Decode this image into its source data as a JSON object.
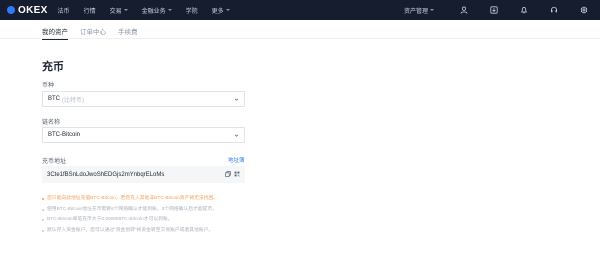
{
  "header": {
    "logo": "OKEX",
    "nav": [
      "法币",
      "行情",
      "交易",
      "金融业务",
      "学院",
      "更多"
    ],
    "asset_menu": "资产管理"
  },
  "subnav": {
    "tabs": [
      "我的资产",
      "订单中心",
      "手续费"
    ],
    "active_tab": "我的资产"
  },
  "page_title": "充币",
  "coin_field": {
    "label": "币种",
    "value": "BTC",
    "hint": "(比特币)"
  },
  "chain_field": {
    "label": "链名称",
    "value": "BTC-Bitcoin"
  },
  "address_field": {
    "label": "充币地址",
    "link": "地址簿",
    "value": "3Cte1fBSnLdoJwoShEDGjs2mYnbqrELoMs"
  },
  "notes": [
    "您只能向此地址充值BTC-Bitcoin，若您充入其他非BTC-Bitcoin资产将无法找回。",
    "使用BTC-Bitcoin地址充币需要6个网络确认才能到账，3个网络确认后才能提币。",
    "BTC-Bitcoin单笔充币大于0.000058TC-Bitcoin才可以到账。",
    "默认存入资金账户，您可以通过“资金划转”将资金转至交易账户或者其他账户。"
  ],
  "colors": {
    "topbar": "#161d2f",
    "accent": "#2f7bf5",
    "warning": "#f0a05a"
  }
}
